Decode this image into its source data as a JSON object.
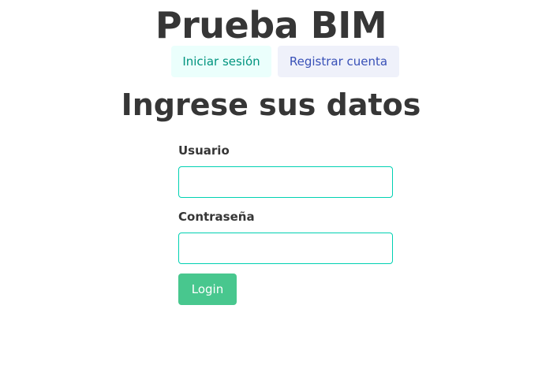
{
  "title": "Prueba BIM",
  "tabs": [
    "Iniciar sesión",
    "Registrar cuenta"
  ],
  "heading": "Ingrese sus datos",
  "form": {
    "user_label": "Usuario",
    "user_value": "",
    "pass_label": "Contraseña",
    "pass_value": "",
    "login": "Login"
  }
}
